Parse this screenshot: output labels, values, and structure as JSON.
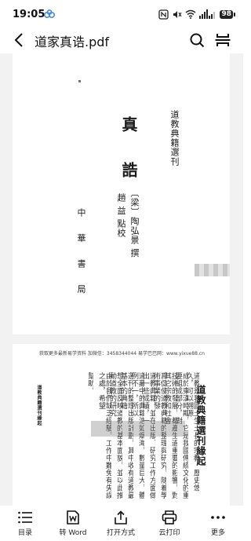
{
  "status_bar": {
    "time": "19:05",
    "battery": "98"
  },
  "header": {
    "title": "道家真诰.pdf"
  },
  "page1": {
    "series_title": "道教典籍選刊",
    "title_char_1": "真",
    "title_char_2": "誥",
    "author": "〔梁〕陶弘景 撰",
    "editor": "趙 益 點校",
    "publisher": "中 華 書 局"
  },
  "page2": {
    "banner": "获取更多最新易学资料 加微信：3458344044 易学巴巴网：www.yixue88.cn",
    "heading": "道教典籍選刊緣起",
    "side_label": "道教典籍選刊緣起",
    "columns": [
      "道教是我國土生土長的宗教，歷史悠久，可以溯源",
      "成於東漢時期，它是我國傳統文化的重要組成部分，對",
      "技術的發展，都產生過重要的影響，對其它宗教和社會",
      "爲促使道教典籍的整理與研究，隨着學術事業的發",
      "道教典籍，並在出版、研究工作方面做出一些成績，一",
      "道藏中的典籍浩如烟海，數量巨大，體例不一，所以",
      "選刊的整理出版計劃，其中收有道教最基本的典籍",
      "想全面反映道教的基本面貌，並以此推動道教的研究",
      "由於我們缺乏經驗，工作中難免有失誤之處，希望",
      "幫助。"
    ]
  },
  "toolbar": {
    "toc": "目录",
    "to_word": "转 Word",
    "open_with": "打开方式",
    "cloud_print": "云打印",
    "more": "更多"
  }
}
